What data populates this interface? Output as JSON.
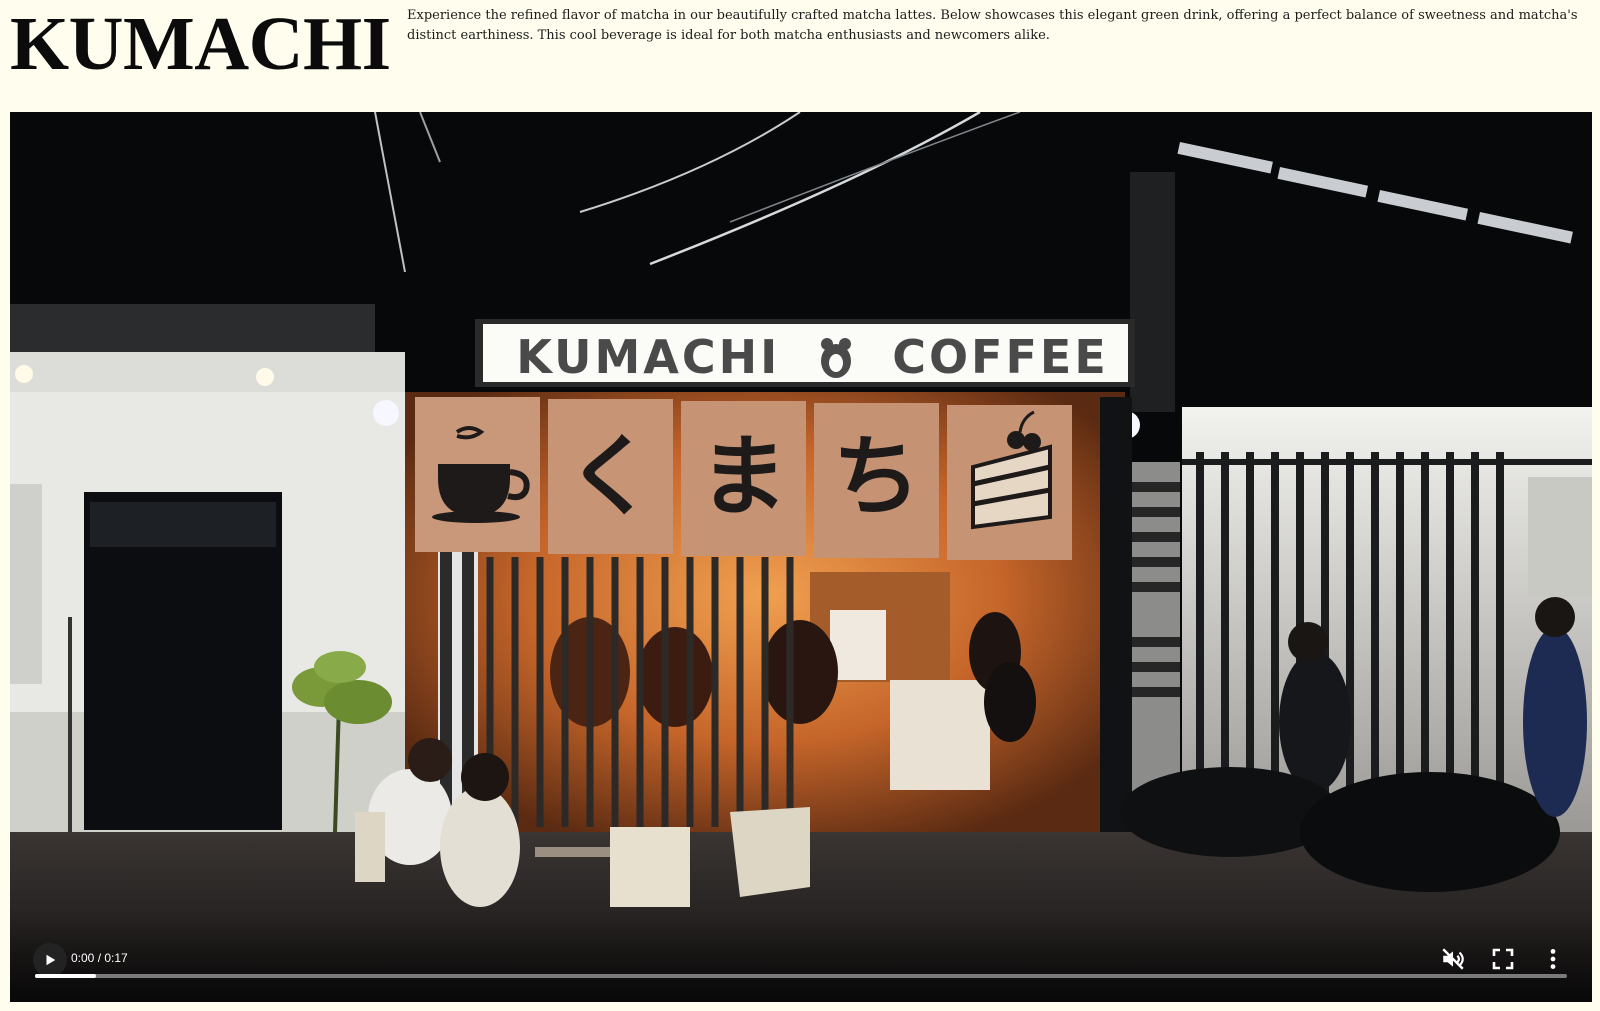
{
  "header": {
    "brand": "KUMACHI",
    "description": "Experience the refined flavor of matcha in our beautifully crafted matcha lattes. Below showcases this elegant green drink, offering a perfect balance of sweetness and matcha's distinct earthiness. This cool beverage is ideal for both matcha enthusiasts and newcomers alike."
  },
  "video": {
    "sign_left": "KUMACHI",
    "sign_right": "COFFEE",
    "curtain_glyphs": [
      "く",
      "ま",
      "ち"
    ],
    "controls": {
      "time": "0:00 / 0:17",
      "progress_fraction": 0.04,
      "play_icon": "play-icon",
      "mute_icon": "volume-muted-icon",
      "fullscreen_icon": "fullscreen-icon",
      "more_icon": "more-vert-icon"
    }
  },
  "colors": {
    "page_background": "#fffdee",
    "interior_glow": "#d9772c",
    "curtain": "#c49372"
  }
}
